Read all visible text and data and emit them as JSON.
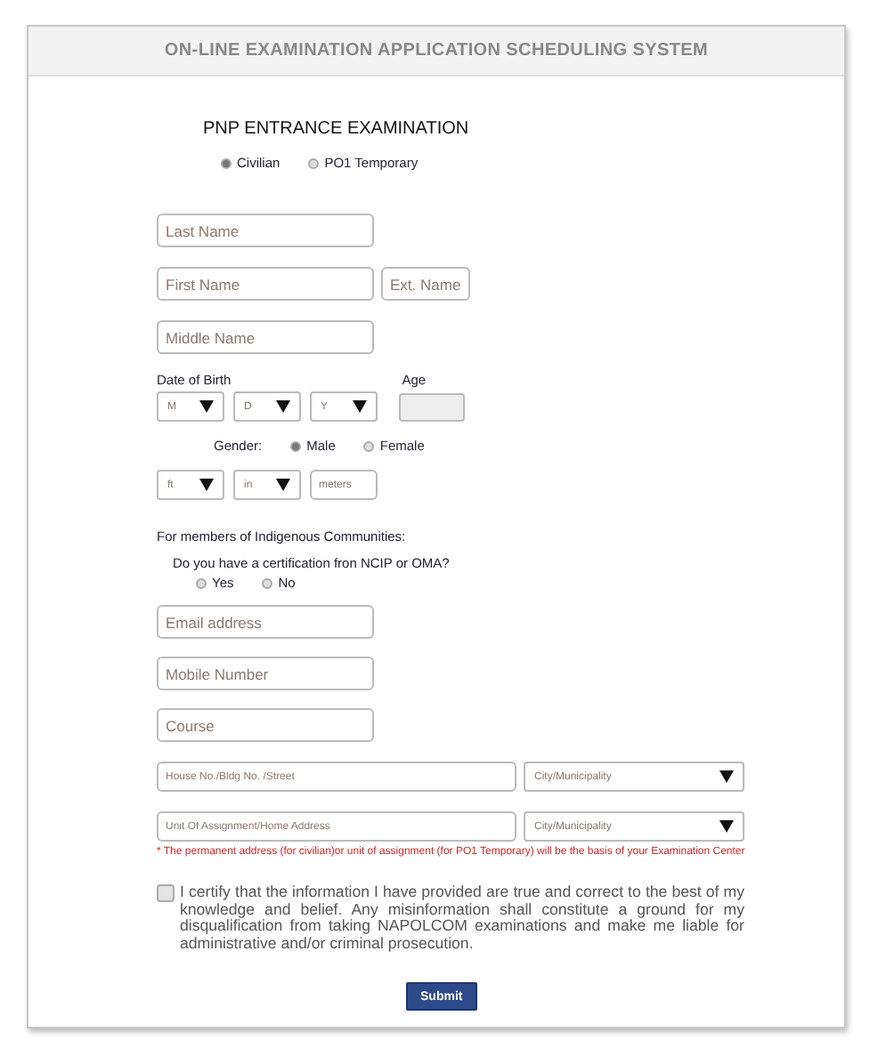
{
  "header": {
    "title": "ON-LINE EXAMINATION APPLICATION SCHEDULING SYSTEM"
  },
  "exam_title": "PNP ENTRANCE EXAMINATION",
  "category": [
    {
      "label": "Civilian",
      "selected": true
    },
    {
      "label": "PO1 Temporary",
      "selected": false
    }
  ],
  "name_fields": {
    "last": {
      "placeholder": "Last Name"
    },
    "first": {
      "placeholder": "First Name"
    },
    "ext": {
      "placeholder": "Ext. Name"
    },
    "middle": {
      "placeholder": "Middle Name"
    }
  },
  "birth": {
    "label": "Date of Birth",
    "selects": [
      "M",
      "D",
      "Y"
    ],
    "age_label": "Age"
  },
  "gender": {
    "label": "Gender:",
    "options": [
      {
        "label": "Male",
        "selected": true
      },
      {
        "label": "Female",
        "selected": false
      }
    ]
  },
  "height": {
    "selects": [
      "ft",
      "in"
    ],
    "meters_placeholder": "meters"
  },
  "indigenous": {
    "heading": "For members of Indigenous Communities:",
    "question": "Do you have a certification fron NCIP or OMA?",
    "options": [
      {
        "label": "Yes",
        "selected": false
      },
      {
        "label": "No",
        "selected": false
      }
    ]
  },
  "contact_fields": [
    {
      "placeholder": "Email address"
    },
    {
      "placeholder": "Mobile Number"
    },
    {
      "placeholder": "Course"
    }
  ],
  "address_rows": [
    {
      "placeholder": "House No./Bldg No. /Street",
      "city": "City/Municipality"
    },
    {
      "placeholder": "Unit Of Assignment/Home Address",
      "city": "City/Municipality"
    }
  ],
  "address_note": "* The permanent address (for civilian)or unit of assignment (for PO1 Temporary) will be the basis of your Examination Center",
  "certification": {
    "checked": false,
    "text": "I certify that the information I have provided are true and correct to the best of my knowledge and belief. Any misinformation shall constitute a ground for my disqualification from taking NAPOLCOM examinations and make me liable for administrative and/or criminal prosecution."
  },
  "submit": "Submit"
}
